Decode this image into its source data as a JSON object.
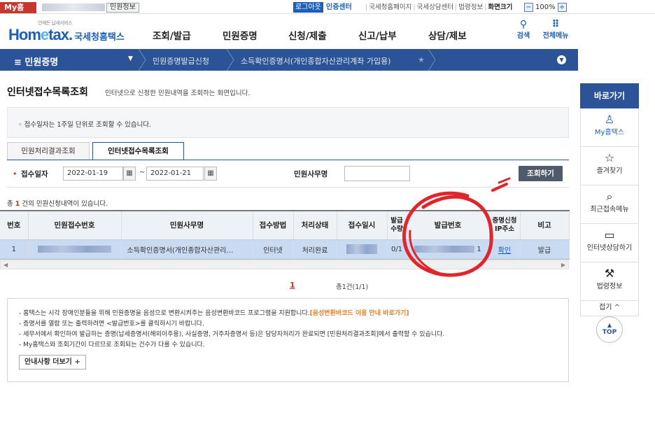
{
  "topbar": {
    "my_label": "My홈",
    "civil_info": "민원정보",
    "logout": "로그아웃",
    "cert_center": "인증센터",
    "links": [
      "국세청홈페이지",
      "국세상담센터",
      "법령정보"
    ],
    "zoom_label": "화면크기",
    "zoom_value": "100%",
    "zoom_minus": "−",
    "zoom_plus": "+"
  },
  "header": {
    "logo_small": "언제든 납세서비스",
    "logo_home": "Hom",
    "logo_e": "e",
    "logo_tax": "tax.",
    "logo_kr": "국세청홈택스",
    "gnb": [
      "조회/발급",
      "민원증명",
      "신청/제출",
      "신고/납부",
      "상담/제보"
    ],
    "search_label": "검색",
    "all_menu_label": "전체메뉴",
    "search_icon": "search-icon",
    "menu_icon": "grid-menu-icon"
  },
  "navbar": {
    "menu": "≡  민원증명",
    "caret": "▼",
    "crumbs": [
      "민원증명발급신청",
      "소득확인증명서(개인종합자산관리계좌 가입용)"
    ],
    "star": "★",
    "down": "▼"
  },
  "page": {
    "title": "인터넷접수목록조회",
    "description": "인터넷으로 신청한 민원내역을 조회하는 화면입니다."
  },
  "notice": "◦ 접수일자는 1주일 단위로 조회할 수 있습니다.",
  "tabs": [
    "민원처리결과조회",
    "인터넷접수목록조회"
  ],
  "search": {
    "required_mark": "•",
    "date_label": "접수일자",
    "date_from": "2022-01-19",
    "date_to": "2022-01-21",
    "tilde": "~",
    "cal_glyph": "▦",
    "name_label": "민원사무명",
    "name_value": "",
    "button": "조회하기"
  },
  "count": {
    "prefix": "총 ",
    "n": "1",
    "suffix": " 건의 민원신청내역이 있습니다."
  },
  "table": {
    "headers": [
      "번호",
      "민원접수번호",
      "민원사무명",
      "접수방법",
      "처리상태",
      "접수일시",
      "발급\n수량",
      "발급번호",
      "증명신청\nIP주소",
      "비고"
    ],
    "rows": [
      {
        "no": "1",
        "service": "소득확인증명서(개인종합자산관리…",
        "method": "인터넷",
        "status": "처리완료",
        "qty": "0/1",
        "issue_suffix": "1",
        "ip": "확인",
        "remark": "발급"
      }
    ]
  },
  "pagination": {
    "current": "1",
    "total": "총1건(1/1)"
  },
  "info": {
    "lines": [
      "- 홈택스는 시각 장애인분들을 위해 민원증명을 음성으로 변환시켜주는 음성변환바코드 프로그램을 지원합니다.",
      "- 증명서를 열람 또는 출력하려면 <발급번호>를 클릭하시기 바랍니다.",
      "- 세무서에서 확인하여 발급하는 증명(납세증명서(해외이주용), 사실증명, 거주자증명서 등)은 담당자처리가 완료되면 [민원처리결과조회]에서 출력할 수 있습니다.",
      "- My홈택스와 조회기간이 다르므로 조회되는 건수가 다를 수 있습니다."
    ],
    "barcode_link": "[음성변환바코드 이용 안내 바로가기]",
    "more_button": "안내사항 더보기 +"
  },
  "quickmenu": {
    "title": "바로가기",
    "items": [
      {
        "label": "My홈택스",
        "icon": "person-icon"
      },
      {
        "label": "즐겨찾기",
        "icon": "star-icon"
      },
      {
        "label": "최근접속메뉴",
        "icon": "recent-search-icon"
      },
      {
        "label": "인터넷상담하기",
        "icon": "monitor-chat-icon"
      },
      {
        "label": "법령정보",
        "icon": "gavel-icon"
      }
    ],
    "fold": "접기 ^",
    "top": "TOP"
  },
  "colors": {
    "brand_blue": "#2c5396",
    "link_blue": "#1c5fb8",
    "accent_red": "#c7312a",
    "annotation_red": "#e0262b"
  }
}
